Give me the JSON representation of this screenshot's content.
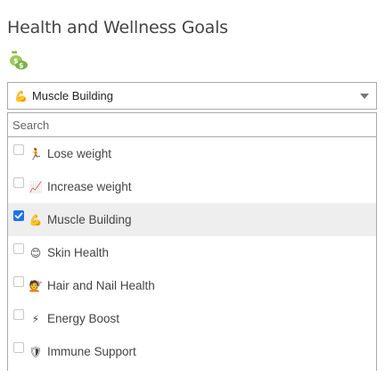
{
  "page": {
    "title": "Health and Wellness Goals",
    "title_icon": "money-bag-icon"
  },
  "select": {
    "selected_emoji": "💪",
    "selected_label": "Muscle Building",
    "caret_icon": "chevron-down-icon"
  },
  "search": {
    "placeholder": "Search",
    "value": ""
  },
  "options": [
    {
      "emoji": "🏃",
      "label": "Lose weight",
      "checked": false,
      "icon": "running-icon"
    },
    {
      "emoji": "📈",
      "label": "Increase weight",
      "checked": false,
      "icon": "chart-up-icon"
    },
    {
      "emoji": "💪",
      "label": "Muscle Building",
      "checked": true,
      "icon": "flexed-biceps-icon"
    },
    {
      "emoji": "😊",
      "label": "Skin Health",
      "checked": false,
      "icon": "smiling-face-icon"
    },
    {
      "emoji": "💇",
      "label": "Hair and Nail Health",
      "checked": false,
      "icon": "haircut-icon"
    },
    {
      "emoji": "⚡",
      "label": "Energy Boost",
      "checked": false,
      "icon": "lightning-icon"
    },
    {
      "emoji": "🛡",
      "label": "Immune Support",
      "checked": false,
      "icon": "shield-icon"
    }
  ],
  "colors": {
    "checkbox_checked": "#1a73e8",
    "selected_row_bg": "#eeeeee",
    "border": "#aaaaaa"
  }
}
